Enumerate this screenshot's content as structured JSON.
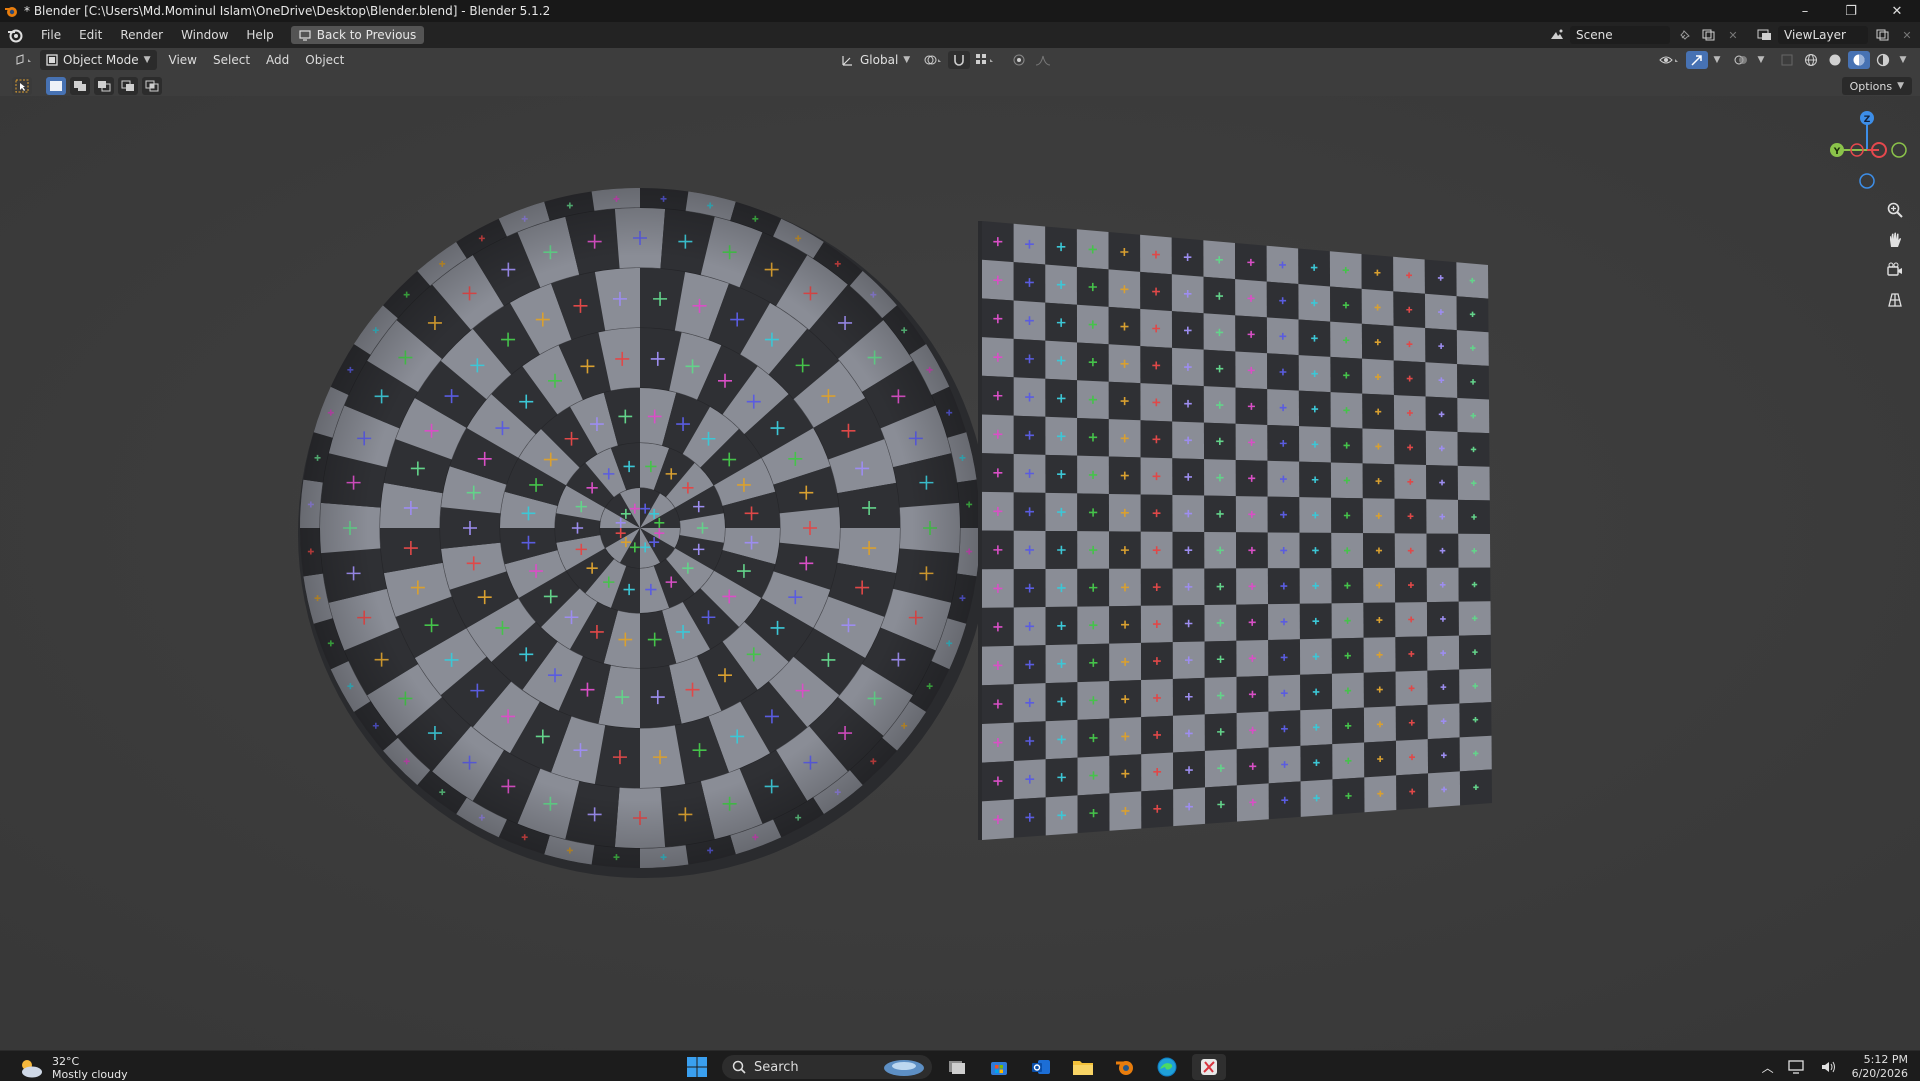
{
  "window": {
    "title": "* Blender [C:\\Users\\Md.Mominul Islam\\OneDrive\\Desktop\\Blender.blend] - Blender 5.1.2",
    "minimize": "–",
    "maximize": "❐",
    "close": "✕"
  },
  "menubar": {
    "items": [
      "File",
      "Edit",
      "Render",
      "Window",
      "Help"
    ],
    "back_label": "Back to Previous",
    "scene_label": "Scene",
    "viewlayer_label": "ViewLayer"
  },
  "viewport_header": {
    "mode_label": "Object Mode",
    "menus": [
      "View",
      "Select",
      "Add",
      "Object"
    ],
    "transform_label": "Global"
  },
  "toolbar": {
    "options_label": "Options"
  },
  "gizmo": {
    "z": "Z",
    "y": "Y",
    "colors": {
      "x": "#e5484d",
      "y": "#8bc34a",
      "z": "#3d8ee8"
    }
  },
  "taskbar": {
    "temperature": "32°C",
    "weather": "Mostly cloudy",
    "search_placeholder": "Search",
    "time": "5:12 PM",
    "date": "6/20/2026"
  },
  "colors": {
    "viewport_bg": "#3d3d3d",
    "checker_light": "#8a8d96",
    "checker_dark": "#2f3034",
    "accent": "#4772b3"
  }
}
